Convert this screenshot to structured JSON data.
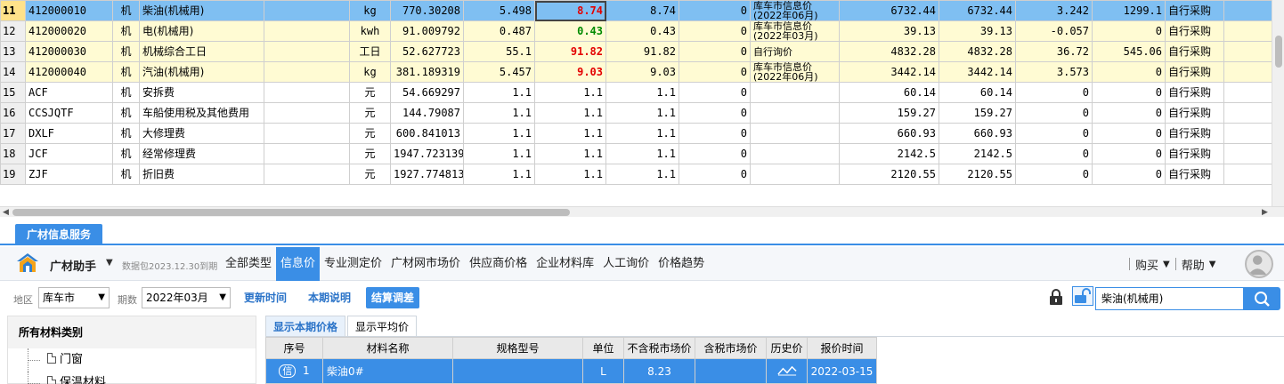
{
  "grid": {
    "rows": [
      {
        "no": "11",
        "code": "412000010",
        "type": "机",
        "name": "柴油(机械用)",
        "spec": "",
        "unit": "kg",
        "qty": "770.30208",
        "base": "5.498",
        "price": "8.74",
        "price_color": "red",
        "tax": "8.74",
        "diff": "0",
        "source": "库车市信息价(2022年06月)",
        "amt1": "6732.44",
        "amt2": "6732.44",
        "c1": "3.242",
        "c2": "1299.1",
        "buy": "自行采购",
        "style": "sel"
      },
      {
        "no": "12",
        "code": "412000020",
        "type": "机",
        "name": "电(机械用)",
        "spec": "",
        "unit": "kwh",
        "qty": "91.009792",
        "base": "0.487",
        "price": "0.43",
        "price_color": "grn",
        "tax": "0.43",
        "diff": "0",
        "source": "库车市信息价(2022年03月)",
        "amt1": "39.13",
        "amt2": "39.13",
        "c1": "-0.057",
        "c2": "0",
        "buy": "自行采购",
        "style": "yel"
      },
      {
        "no": "13",
        "code": "412000030",
        "type": "机",
        "name": "机械综合工日",
        "spec": "",
        "unit": "工日",
        "qty": "52.627723",
        "base": "55.1",
        "price": "91.82",
        "price_color": "red",
        "tax": "91.82",
        "diff": "0",
        "source": "自行询价",
        "amt1": "4832.28",
        "amt2": "4832.28",
        "c1": "36.72",
        "c2": "545.06",
        "buy": "自行采购",
        "style": "yel"
      },
      {
        "no": "14",
        "code": "412000040",
        "type": "机",
        "name": "汽油(机械用)",
        "spec": "",
        "unit": "kg",
        "qty": "381.189319",
        "base": "5.457",
        "price": "9.03",
        "price_color": "red",
        "tax": "9.03",
        "diff": "0",
        "source": "库车市信息价(2022年06月)",
        "amt1": "3442.14",
        "amt2": "3442.14",
        "c1": "3.573",
        "c2": "0",
        "buy": "自行采购",
        "style": "yel"
      },
      {
        "no": "15",
        "code": "ACF",
        "type": "机",
        "name": "安拆费",
        "spec": "",
        "unit": "元",
        "qty": "54.669297",
        "base": "1.1",
        "price": "1.1",
        "price_color": "",
        "tax": "1.1",
        "diff": "0",
        "source": "",
        "amt1": "60.14",
        "amt2": "60.14",
        "c1": "0",
        "c2": "0",
        "buy": "自行采购",
        "style": ""
      },
      {
        "no": "16",
        "code": "CCSJQTF",
        "type": "机",
        "name": "车船使用税及其他费用",
        "spec": "",
        "unit": "元",
        "qty": "144.79087",
        "base": "1.1",
        "price": "1.1",
        "price_color": "",
        "tax": "1.1",
        "diff": "0",
        "source": "",
        "amt1": "159.27",
        "amt2": "159.27",
        "c1": "0",
        "c2": "0",
        "buy": "自行采购",
        "style": ""
      },
      {
        "no": "17",
        "code": "DXLF",
        "type": "机",
        "name": "大修理费",
        "spec": "",
        "unit": "元",
        "qty": "600.841013",
        "base": "1.1",
        "price": "1.1",
        "price_color": "",
        "tax": "1.1",
        "diff": "0",
        "source": "",
        "amt1": "660.93",
        "amt2": "660.93",
        "c1": "0",
        "c2": "0",
        "buy": "自行采购",
        "style": ""
      },
      {
        "no": "18",
        "code": "JCF",
        "type": "机",
        "name": "经常修理费",
        "spec": "",
        "unit": "元",
        "qty": "1947.723139",
        "base": "1.1",
        "price": "1.1",
        "price_color": "",
        "tax": "1.1",
        "diff": "0",
        "source": "",
        "amt1": "2142.5",
        "amt2": "2142.5",
        "c1": "0",
        "c2": "0",
        "buy": "自行采购",
        "style": ""
      },
      {
        "no": "19",
        "code": "ZJF",
        "type": "机",
        "name": "折旧费",
        "spec": "",
        "unit": "元",
        "qty": "1927.774813",
        "base": "1.1",
        "price": "1.1",
        "price_color": "",
        "tax": "1.1",
        "diff": "0",
        "source": "",
        "amt1": "2120.55",
        "amt2": "2120.55",
        "c1": "0",
        "c2": "0",
        "buy": "自行采购",
        "style": ""
      }
    ]
  },
  "panel_tab": "广材信息服务",
  "toolbar": {
    "brand": "广材助手",
    "package": "数据包2023.12.30到期",
    "menu": [
      "全部类型",
      "信息价",
      "专业测定价",
      "广材网市场价",
      "供应商价格",
      "企业材料库",
      "人工询价",
      "价格趋势"
    ],
    "active_menu": 1,
    "buy": "购买",
    "help": "帮助"
  },
  "filter": {
    "region_label": "地区",
    "region": "库车市",
    "period_label": "期数",
    "period": "2022年03月",
    "update_time": "更新时间",
    "period_note": "本期说明",
    "settle": "结算调差",
    "search_value": "柴油(机械用)"
  },
  "left": {
    "title": "所有材料类别",
    "items": [
      "门窗",
      "保温材料"
    ]
  },
  "right": {
    "tabs": [
      "显示本期价格",
      "显示平均价"
    ],
    "headers": [
      "序号",
      "材料名称",
      "规格型号",
      "单位",
      "不含税市场价",
      "含税市场价",
      "历史价",
      "报价时间"
    ],
    "row": {
      "tag": "信",
      "no": "1",
      "name": "柴油0#",
      "spec": "",
      "unit": "L",
      "price": "8.23",
      "taxprice": "",
      "date": "2022-03-15"
    }
  }
}
